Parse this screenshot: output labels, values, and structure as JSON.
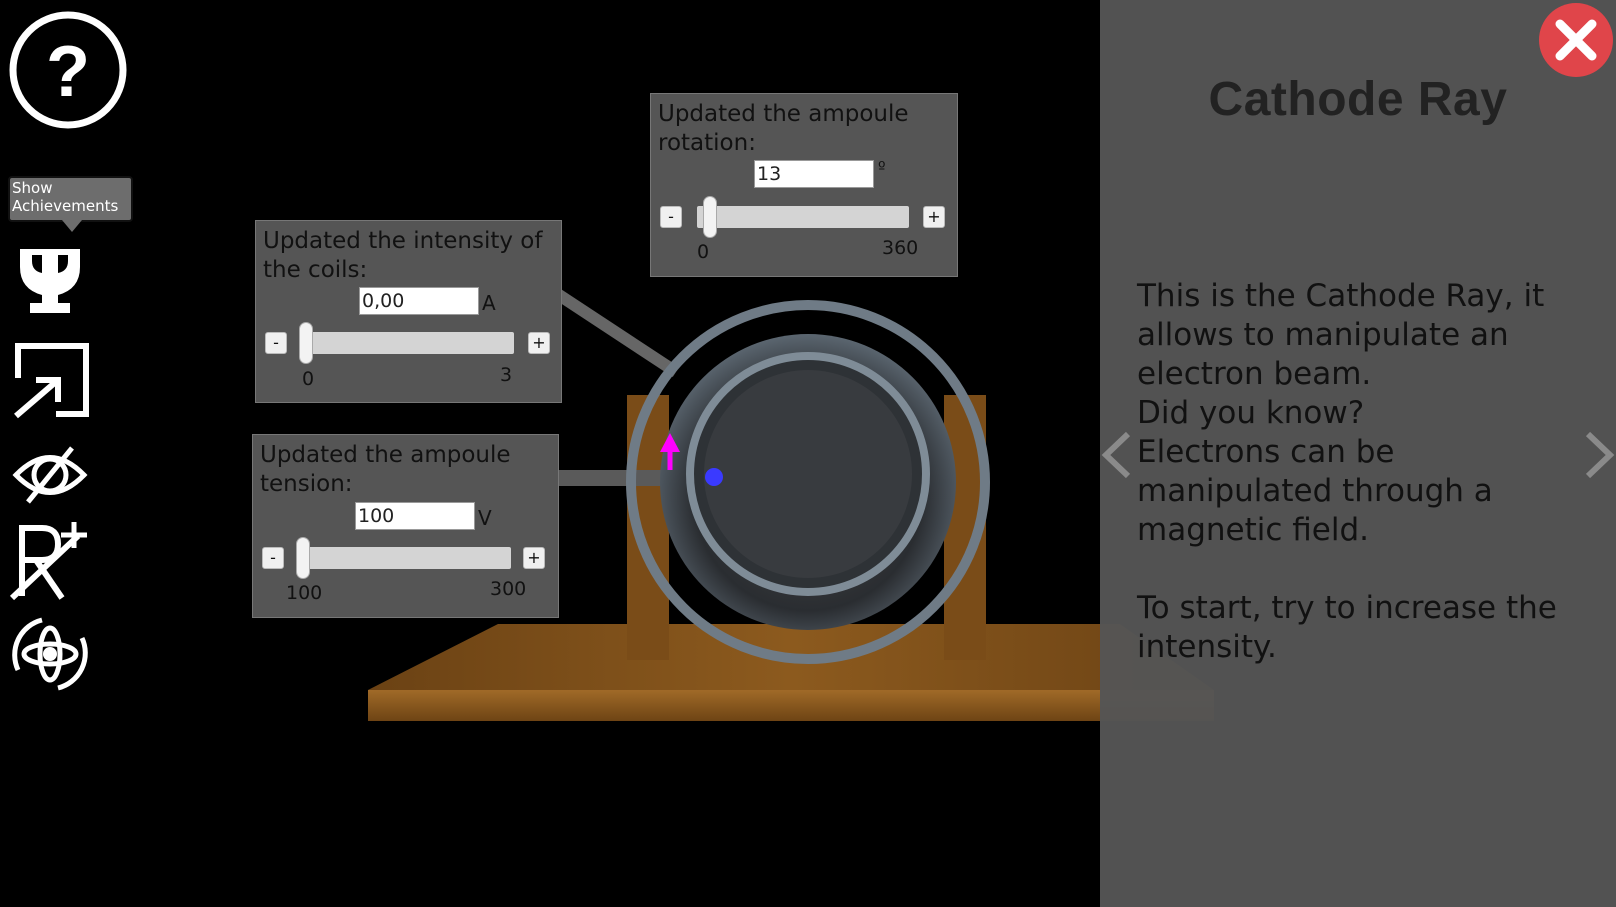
{
  "toolbar": {
    "tooltip": "Show Achievements",
    "icons": [
      "help-icon",
      "trophy-icon",
      "expand-icon",
      "hide-eye-icon",
      "add-resistor-icon",
      "rotate-view-icon"
    ]
  },
  "panels": {
    "rotation": {
      "title": "Updated the ampoule rotation:",
      "value": "13",
      "unit": "º",
      "min": "0",
      "max": "360",
      "minus": "-",
      "plus": "+"
    },
    "intensity": {
      "title": "Updated the intensity of the coils:",
      "value": "0,00",
      "unit": "A",
      "min": "0",
      "max": "3",
      "minus": "-",
      "plus": "+"
    },
    "tension": {
      "title": "Updated the ampoule tension:",
      "value": "100",
      "unit": "V",
      "min": "100",
      "max": "300",
      "minus": "-",
      "plus": "+"
    }
  },
  "info": {
    "title": "Cathode Ray",
    "body": "This is the Cathode Ray, it allows to manipulate an electron beam.\nDid you know?\nElectrons can be manipulated through a magnetic field.\n\nTo start, try to increase the intensity."
  },
  "colors": {
    "panel_bg": "#555555",
    "close_red": "#e0454a",
    "wood": "#8a5a1e",
    "arrow": "#ff00ff",
    "dot": "#3333ff"
  }
}
